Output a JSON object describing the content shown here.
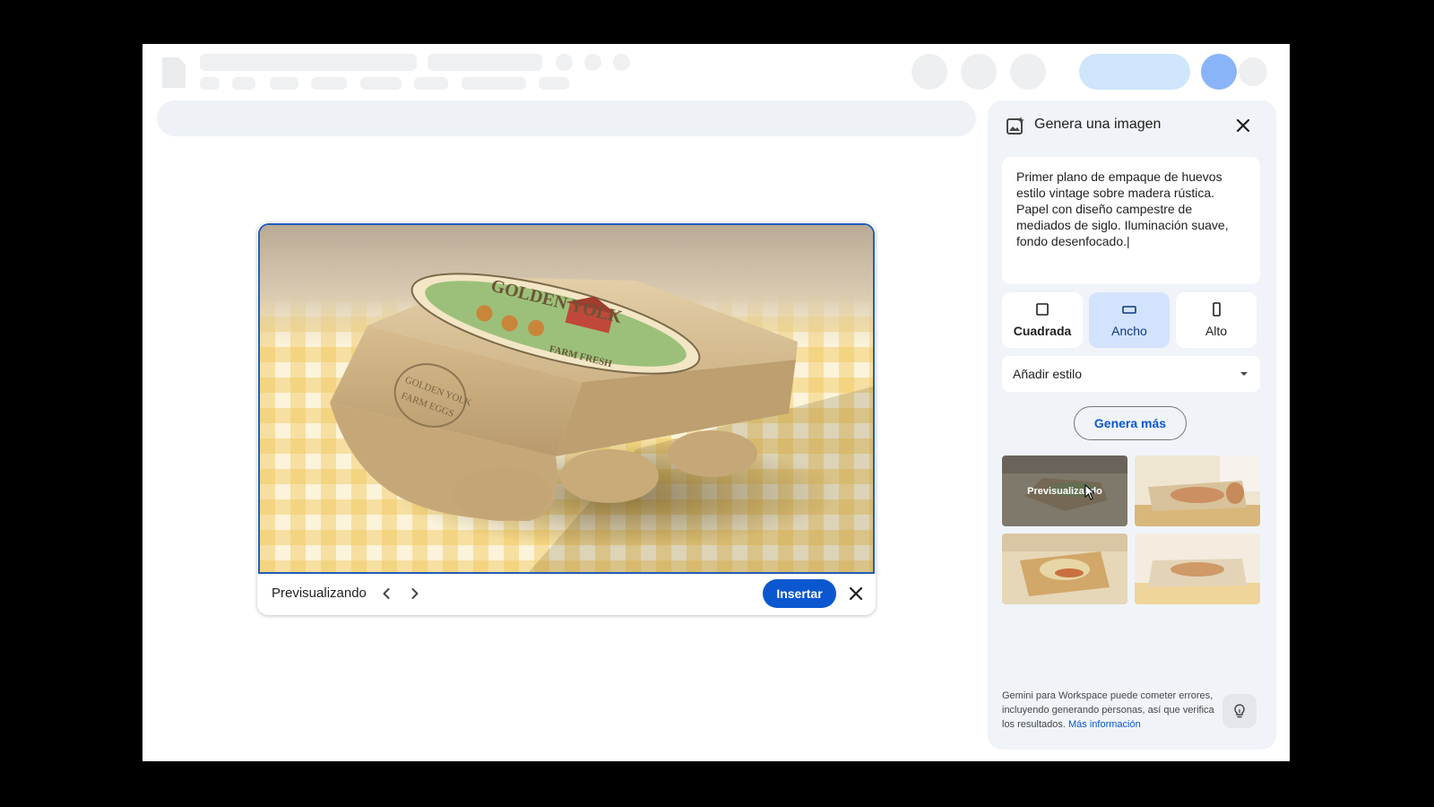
{
  "preview": {
    "status_label": "Previsualizando",
    "insert_label": "Insertar",
    "product": {
      "carton_brand": "GOLDEN YOLK",
      "label_sub": "FARM FRESH",
      "stamp_line1": "GOLDEN YOLK",
      "stamp_line2": "FARM EGGS"
    }
  },
  "panel": {
    "title": "Genera una imagen",
    "prompt": "Primer plano de empaque de huevos estilo vintage sobre madera rústica. Papel con diseño campestre de mediados de siglo. Iluminación suave, fondo desenfocado.|",
    "aspect_options": [
      {
        "label": "Cuadrada",
        "icon": "square-icon",
        "selected": false
      },
      {
        "label": "Ancho",
        "icon": "landscape-icon",
        "selected": true
      },
      {
        "label": "Alto",
        "icon": "portrait-icon",
        "selected": false
      }
    ],
    "style_select": "Añadir estilo",
    "generate_more": "Genera más",
    "thumbnail_overlay": "Previsualizando",
    "disclaimer_text": "Gemini para Workspace puede cometer errores, incluyendo generando personas, así que verifica los resultados.",
    "disclaimer_link": "Más información"
  },
  "colors": {
    "accent": "#0b57d0",
    "selected_bg": "#d3e3fd",
    "panel_bg": "#f0f4f9",
    "preview_border": "#1f5fb8"
  }
}
